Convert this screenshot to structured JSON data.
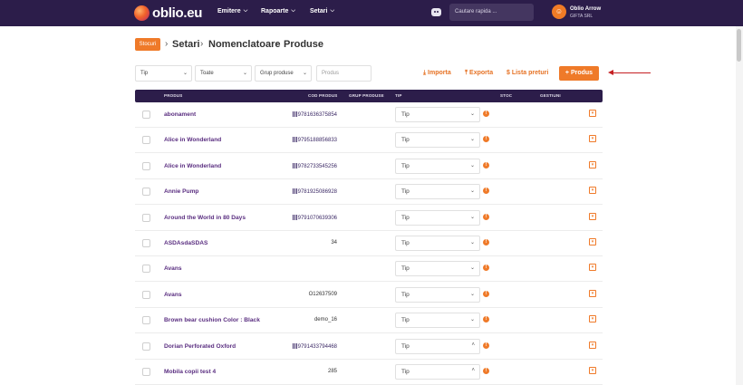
{
  "brand": {
    "name": "oblio.eu"
  },
  "nav": {
    "items": [
      {
        "label": "Emitere"
      },
      {
        "label": "Rapoarte"
      },
      {
        "label": "Setari"
      }
    ],
    "search_placeholder": "Cautare rapida ...",
    "user": {
      "initial": "☺",
      "name": "Oblio Arrow",
      "company": "GIFTA SRL"
    }
  },
  "breadcrumb": {
    "badge": "Stocuri",
    "items": [
      "Setari",
      "Nomenclatoare",
      "Produse"
    ],
    "separator": "›"
  },
  "filters": {
    "tip": "Tip",
    "toate": "Toate",
    "grup": "Grup produse",
    "produs_placeholder": "Produs"
  },
  "actions": {
    "import": "⤓ Importa",
    "export": "⤒ Exporta",
    "price_list": "$ Lista preturi",
    "add_product": "+ Produs"
  },
  "table": {
    "headers": [
      "PRODUS",
      "COD PRODUS",
      "GRUP PRODUSE",
      "TIP",
      "STOC",
      "GESTIUNI"
    ],
    "select_placeholder": "Tip",
    "rows": [
      {
        "name": "abonament",
        "code": "9781636375854",
        "barcode": true,
        "open": false
      },
      {
        "name": "Alice in Wonderland",
        "code": "9795188856833",
        "barcode": true,
        "open": false
      },
      {
        "name": "Alice in Wonderland",
        "code": "9782733545256",
        "barcode": true,
        "open": false
      },
      {
        "name": "Annie Pump",
        "code": "9781925086928",
        "barcode": true,
        "open": false
      },
      {
        "name": "Around the World in 80 Days",
        "code": "9791070639306",
        "barcode": true,
        "open": false
      },
      {
        "name": "ASDAsdaSDAS",
        "code": "34",
        "barcode": false,
        "open": false
      },
      {
        "name": "Avans",
        "code": "",
        "barcode": false,
        "open": false
      },
      {
        "name": "Avans",
        "code": "O12637509",
        "barcode": false,
        "open": false
      },
      {
        "name": "Brown bear cushion Color : Black",
        "code": "demo_16",
        "barcode": false,
        "open": false
      },
      {
        "name": "Dorian Perforated Oxford",
        "code": "9791433794468",
        "barcode": true,
        "open": true
      },
      {
        "name": "Mobila copii test 4",
        "code": "285",
        "barcode": false,
        "open": true
      }
    ]
  },
  "colors": {
    "nav": "#2c1d4a",
    "accent": "#ef7a29",
    "link": "#5a2e80",
    "arrow": "#c51f22"
  }
}
